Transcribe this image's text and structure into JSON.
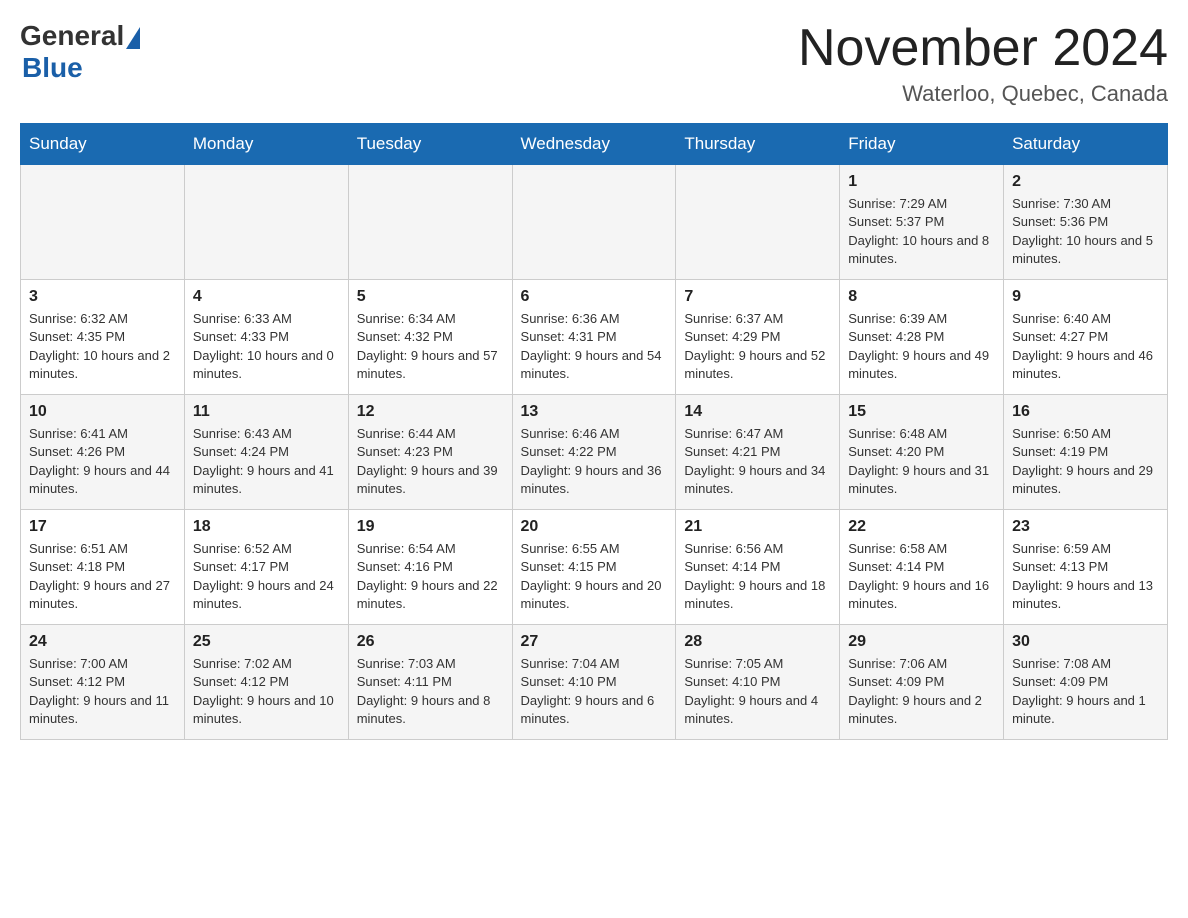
{
  "header": {
    "logo_general": "General",
    "logo_blue": "Blue",
    "title": "November 2024",
    "location": "Waterloo, Quebec, Canada"
  },
  "weekdays": [
    "Sunday",
    "Monday",
    "Tuesday",
    "Wednesday",
    "Thursday",
    "Friday",
    "Saturday"
  ],
  "rows": [
    [
      {
        "day": "",
        "info": ""
      },
      {
        "day": "",
        "info": ""
      },
      {
        "day": "",
        "info": ""
      },
      {
        "day": "",
        "info": ""
      },
      {
        "day": "",
        "info": ""
      },
      {
        "day": "1",
        "info": "Sunrise: 7:29 AM\nSunset: 5:37 PM\nDaylight: 10 hours and 8 minutes."
      },
      {
        "day": "2",
        "info": "Sunrise: 7:30 AM\nSunset: 5:36 PM\nDaylight: 10 hours and 5 minutes."
      }
    ],
    [
      {
        "day": "3",
        "info": "Sunrise: 6:32 AM\nSunset: 4:35 PM\nDaylight: 10 hours and 2 minutes."
      },
      {
        "day": "4",
        "info": "Sunrise: 6:33 AM\nSunset: 4:33 PM\nDaylight: 10 hours and 0 minutes."
      },
      {
        "day": "5",
        "info": "Sunrise: 6:34 AM\nSunset: 4:32 PM\nDaylight: 9 hours and 57 minutes."
      },
      {
        "day": "6",
        "info": "Sunrise: 6:36 AM\nSunset: 4:31 PM\nDaylight: 9 hours and 54 minutes."
      },
      {
        "day": "7",
        "info": "Sunrise: 6:37 AM\nSunset: 4:29 PM\nDaylight: 9 hours and 52 minutes."
      },
      {
        "day": "8",
        "info": "Sunrise: 6:39 AM\nSunset: 4:28 PM\nDaylight: 9 hours and 49 minutes."
      },
      {
        "day": "9",
        "info": "Sunrise: 6:40 AM\nSunset: 4:27 PM\nDaylight: 9 hours and 46 minutes."
      }
    ],
    [
      {
        "day": "10",
        "info": "Sunrise: 6:41 AM\nSunset: 4:26 PM\nDaylight: 9 hours and 44 minutes."
      },
      {
        "day": "11",
        "info": "Sunrise: 6:43 AM\nSunset: 4:24 PM\nDaylight: 9 hours and 41 minutes."
      },
      {
        "day": "12",
        "info": "Sunrise: 6:44 AM\nSunset: 4:23 PM\nDaylight: 9 hours and 39 minutes."
      },
      {
        "day": "13",
        "info": "Sunrise: 6:46 AM\nSunset: 4:22 PM\nDaylight: 9 hours and 36 minutes."
      },
      {
        "day": "14",
        "info": "Sunrise: 6:47 AM\nSunset: 4:21 PM\nDaylight: 9 hours and 34 minutes."
      },
      {
        "day": "15",
        "info": "Sunrise: 6:48 AM\nSunset: 4:20 PM\nDaylight: 9 hours and 31 minutes."
      },
      {
        "day": "16",
        "info": "Sunrise: 6:50 AM\nSunset: 4:19 PM\nDaylight: 9 hours and 29 minutes."
      }
    ],
    [
      {
        "day": "17",
        "info": "Sunrise: 6:51 AM\nSunset: 4:18 PM\nDaylight: 9 hours and 27 minutes."
      },
      {
        "day": "18",
        "info": "Sunrise: 6:52 AM\nSunset: 4:17 PM\nDaylight: 9 hours and 24 minutes."
      },
      {
        "day": "19",
        "info": "Sunrise: 6:54 AM\nSunset: 4:16 PM\nDaylight: 9 hours and 22 minutes."
      },
      {
        "day": "20",
        "info": "Sunrise: 6:55 AM\nSunset: 4:15 PM\nDaylight: 9 hours and 20 minutes."
      },
      {
        "day": "21",
        "info": "Sunrise: 6:56 AM\nSunset: 4:14 PM\nDaylight: 9 hours and 18 minutes."
      },
      {
        "day": "22",
        "info": "Sunrise: 6:58 AM\nSunset: 4:14 PM\nDaylight: 9 hours and 16 minutes."
      },
      {
        "day": "23",
        "info": "Sunrise: 6:59 AM\nSunset: 4:13 PM\nDaylight: 9 hours and 13 minutes."
      }
    ],
    [
      {
        "day": "24",
        "info": "Sunrise: 7:00 AM\nSunset: 4:12 PM\nDaylight: 9 hours and 11 minutes."
      },
      {
        "day": "25",
        "info": "Sunrise: 7:02 AM\nSunset: 4:12 PM\nDaylight: 9 hours and 10 minutes."
      },
      {
        "day": "26",
        "info": "Sunrise: 7:03 AM\nSunset: 4:11 PM\nDaylight: 9 hours and 8 minutes."
      },
      {
        "day": "27",
        "info": "Sunrise: 7:04 AM\nSunset: 4:10 PM\nDaylight: 9 hours and 6 minutes."
      },
      {
        "day": "28",
        "info": "Sunrise: 7:05 AM\nSunset: 4:10 PM\nDaylight: 9 hours and 4 minutes."
      },
      {
        "day": "29",
        "info": "Sunrise: 7:06 AM\nSunset: 4:09 PM\nDaylight: 9 hours and 2 minutes."
      },
      {
        "day": "30",
        "info": "Sunrise: 7:08 AM\nSunset: 4:09 PM\nDaylight: 9 hours and 1 minute."
      }
    ]
  ]
}
